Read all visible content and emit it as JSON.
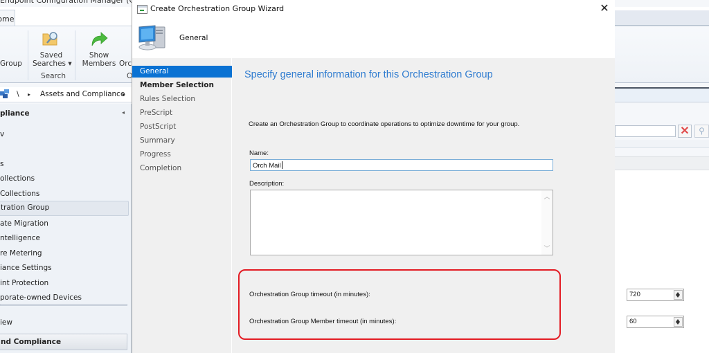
{
  "background_app": {
    "window_title": "Endpoint Configuration Manager (Connected",
    "ribbon_tab": "Home",
    "ribbon_buttons": [
      {
        "label_line1": "",
        "label_line2": "Group",
        "icon": "group-icon"
      },
      {
        "label_line1": "Saved",
        "label_line2": "Searches ▾",
        "icon": "saved-searches-icon"
      },
      {
        "label_line1": "Show",
        "label_line2": "Members",
        "icon": "show-members-arrow-icon"
      },
      {
        "label_line1": "",
        "label_line2": "Orc",
        "icon": ""
      }
    ],
    "ribbon_groups": [
      "Search",
      "O"
    ],
    "breadcrumb": {
      "root_separator": "\\",
      "arrow": "▸",
      "item": "Assets and Compliance",
      "trailing_arrow": "▸"
    },
    "nav": {
      "header": "Compliance",
      "header_prefix_clipped": "pliance",
      "items": [
        {
          "label": "v",
          "selected": false
        },
        {
          "label": "s",
          "selected": false
        },
        {
          "label": "ollections",
          "selected": false
        },
        {
          "label": " Collections",
          "selected": false
        },
        {
          "label": "tration Group",
          "selected": true
        },
        {
          "label": "ate Migration",
          "selected": false
        },
        {
          "label": "ntelligence",
          "selected": false
        },
        {
          "label": "re Metering",
          "selected": false
        },
        {
          "label": "iance Settings",
          "selected": false
        },
        {
          "label": "int Protection",
          "selected": false
        },
        {
          "label": "porate-owned Devices",
          "selected": false
        }
      ],
      "workspaces": [
        {
          "label": "iew",
          "selected": false
        },
        {
          "label": "nd Compliance",
          "selected": true
        }
      ]
    }
  },
  "wizard": {
    "title": "Create Orchestration Group Wizard",
    "close_glyph": "✕",
    "header_title": "General",
    "steps": [
      {
        "label": "General",
        "state": "active"
      },
      {
        "label": "Member Selection",
        "state": "current"
      },
      {
        "label": "Rules Selection",
        "state": "pending"
      },
      {
        "label": "PreScript",
        "state": "pending"
      },
      {
        "label": "PostScript",
        "state": "pending"
      },
      {
        "label": "Summary",
        "state": "pending"
      },
      {
        "label": "Progress",
        "state": "pending"
      },
      {
        "label": "Completion",
        "state": "pending"
      }
    ],
    "heading": "Specify general information for this Orchestration Group",
    "intro": "Create an Orchestration Group to coordinate operations to optimize downtime for your group.",
    "name_label": "Name:",
    "name_value": "Orch Mail",
    "description_label": "Description:",
    "description_value": "",
    "group_timeout_label": "Orchestration Group timeout (in minutes):",
    "group_timeout_value": "720",
    "member_timeout_label": "Orchestration Group Member timeout (in minutes):",
    "member_timeout_value": "60",
    "highlight_color": "#e31b23",
    "accent_color": "#0a72d3"
  }
}
